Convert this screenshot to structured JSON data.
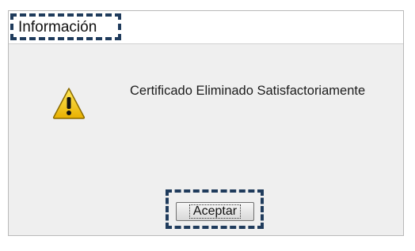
{
  "dialog": {
    "title": "Información",
    "message": "Certificado Eliminado Satisfactoriamente",
    "icon": "warning-icon",
    "ok_label": "Aceptar"
  },
  "colors": {
    "highlight": "#1f3b5c",
    "warning_yellow": "#f5c400",
    "dialog_background": "#efefef"
  }
}
